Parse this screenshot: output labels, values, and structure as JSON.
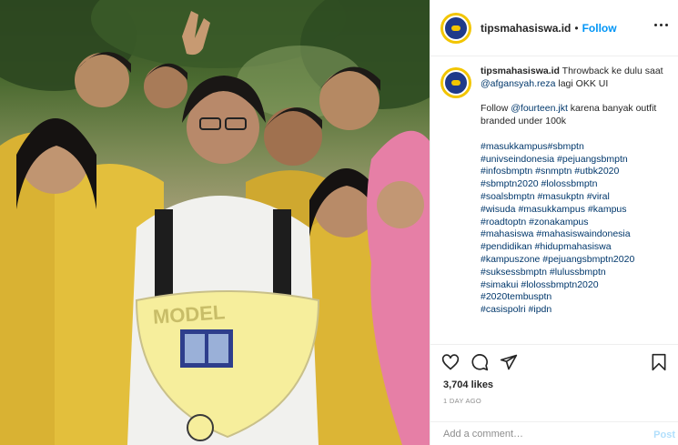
{
  "post": {
    "username": "tipsmahasiswa.id",
    "separator": "•",
    "follow_label": "Follow",
    "more_icon": "more-horizontal-icon",
    "avatar_icon": "profile-logo-icon"
  },
  "photo": {
    "alt": "Group photo of students in yellow jackets",
    "sign_text": "MODEL"
  },
  "caption": {
    "username": "tipsmahasiswa.id",
    "line1_text": " Throwback ke dulu saat ",
    "mention1": "@afgansyah.reza",
    "line1_tail": " lagi OKK UI",
    "line2_head": "Follow ",
    "mention2": "@fourteen.jkt",
    "line2_tail": " karena banyak outfit branded under 100k",
    "hashtags": [
      "#masukkampus#sbmptn",
      "#univseindonesia #pejuangsbmptn",
      "#infosbmptn #snmptn #utbk2020",
      "#sbmptn2020 #lolossbmptn",
      "#soalsbmptn #masukptn #viral",
      "#wisuda #masukkampus #kampus",
      "#roadtoptn #zonakampus",
      "#mahasiswa #mahasiswaindonesia",
      "#pendidikan #hidupmahasiswa",
      "#kampuszone #pejuangsbmptn2020",
      "#suksessbmptn #lulussbmptn",
      "#simakui #lolossbmptn2020",
      "#2020tembusptn",
      "#casispolri #ipdn"
    ]
  },
  "actions": {
    "like_icon": "heart-icon",
    "comment_icon": "comment-icon",
    "share_icon": "share-icon",
    "save_icon": "bookmark-icon"
  },
  "stats": {
    "likes": "3,704 likes",
    "date": "1 DAY AGO"
  },
  "comment": {
    "placeholder": "Add a comment…",
    "post_label": "Post"
  },
  "colors": {
    "accent": "#0095f6",
    "link": "#00376b",
    "post_disabled": "#b2dffc",
    "muted": "#8e8e8e",
    "border": "#efefef"
  }
}
